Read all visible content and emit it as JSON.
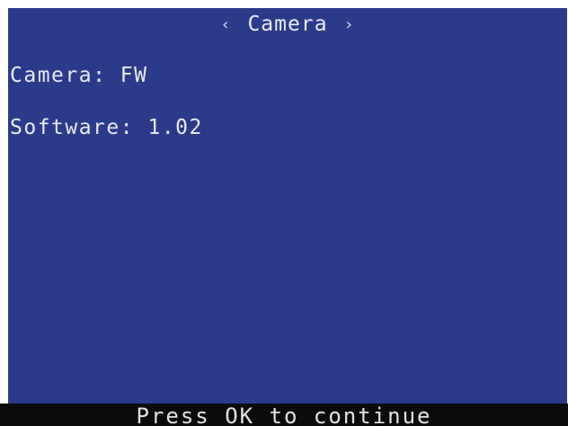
{
  "header": {
    "prev_icon": "chevron-left-icon",
    "prev_glyph": "‹",
    "title": "Camera",
    "next_icon": "chevron-right-icon",
    "next_glyph": "›"
  },
  "info": {
    "camera_label": "Camera:",
    "camera_value": "FW",
    "software_label": "Software:",
    "software_value": "1.02"
  },
  "footer": {
    "prompt": "Press OK to continue"
  },
  "colors": {
    "screen_background": "#2a3b8a",
    "text": "#e9eaf5",
    "footer_background": "#0b0b0b"
  }
}
